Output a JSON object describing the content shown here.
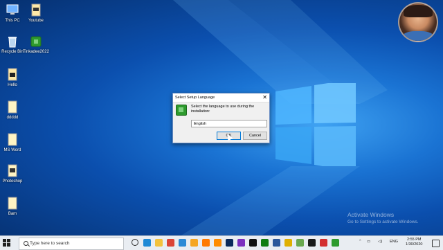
{
  "desktop": {
    "icons": [
      {
        "label": "This PC",
        "icon": "computer-icon",
        "color": "#6fb2ff"
      },
      {
        "label": "Youtube",
        "icon": "file-icon",
        "color": "#ffe9a8"
      },
      {
        "label": "Recycle Bin",
        "icon": "recycle-bin-icon",
        "color": "#bcd7f0"
      },
      {
        "label": "Tinkadee2022",
        "icon": "setup-icon",
        "color": "#2e9a2e"
      },
      {
        "label": "Hello",
        "icon": "file-icon",
        "color": "#ffe9a8"
      },
      {
        "label": "ddddd",
        "icon": "file-icon",
        "color": "#fff4c4"
      },
      {
        "label": "MS Word",
        "icon": "file-icon",
        "color": "#fff4c4"
      },
      {
        "label": "Photoshop",
        "icon": "file-icon",
        "color": "#fff4c4"
      },
      {
        "label": "Bam",
        "icon": "file-icon",
        "color": "#fff4c4"
      }
    ]
  },
  "dialog": {
    "title": "Select Setup Language",
    "message": "Select the language to use during the installation:",
    "language": "English",
    "ok_label": "OK",
    "cancel_label": "Cancel"
  },
  "watermark": {
    "line1": "Activate Windows",
    "line2": "Go to Settings to activate Windows."
  },
  "taskbar": {
    "search_placeholder": "Type here to search",
    "pinned": [
      {
        "icon": "task-view-icon",
        "color": "#2b2b2b"
      },
      {
        "icon": "edge-icon",
        "color": "#1f8ad6"
      },
      {
        "icon": "file-explorer-icon",
        "color": "#f3c23c"
      },
      {
        "icon": "chrome-icon",
        "color": "#db4437"
      },
      {
        "icon": "app-icon",
        "color": "#2b8ad6"
      },
      {
        "icon": "app-icon",
        "color": "#f5a623"
      },
      {
        "icon": "app-icon",
        "color": "#ff7a00"
      },
      {
        "icon": "app-icon",
        "color": "#ff8c00"
      },
      {
        "icon": "photoshop-icon",
        "color": "#0b2a5a"
      },
      {
        "icon": "app-icon",
        "color": "#7b2fbe"
      },
      {
        "icon": "app-icon",
        "color": "#111111"
      },
      {
        "icon": "xbox-icon",
        "color": "#107c10"
      },
      {
        "icon": "word-icon",
        "color": "#2b579a"
      },
      {
        "icon": "app-icon",
        "color": "#e0b000"
      },
      {
        "icon": "app-icon",
        "color": "#6aa84f"
      },
      {
        "icon": "terminal-icon",
        "color": "#1a1a1a"
      },
      {
        "icon": "app-icon",
        "color": "#d32f2f"
      },
      {
        "icon": "setup-icon",
        "color": "#2e9a2e"
      }
    ],
    "language": "ENG",
    "time": "2:55 PM",
    "date": "1/30/2020"
  }
}
